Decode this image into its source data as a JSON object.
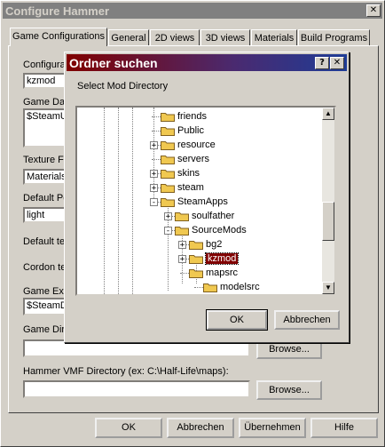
{
  "window": {
    "title": "Configure Hammer",
    "close_glyph": "✕"
  },
  "tabs": [
    "Game Configurations",
    "General",
    "2D views",
    "3D views",
    "Materials",
    "Build Programs"
  ],
  "panel": {
    "configurations_label": "Configurat",
    "configurations_value": "kzmod",
    "game_data_label": "Game Dat",
    "game_data_value": "$SteamU",
    "texture_format_label": "Texture Fo",
    "texture_format_value": "Materials",
    "default_point_label": "Default Po",
    "default_point_value": "light",
    "default_texture_label": "Default te",
    "cordon_texture_label": "Cordon te",
    "game_exe_label": "Game Exe",
    "game_exe_value": "$SteamD",
    "game_dir_label": "Game Dire",
    "game_dir_browse": "Browse...",
    "vmf_dir_label": "Hammer VMF Directory (ex: C:\\Half-Life\\maps):",
    "vmf_dir_browse": "Browse..."
  },
  "footer": {
    "ok": "OK",
    "cancel": "Abbrechen",
    "apply": "Übernehmen",
    "help": "Hilfe"
  },
  "dialog": {
    "title": "Ordner suchen",
    "help_glyph": "?",
    "close_glyph": "✕",
    "prompt": "Select Mod Directory",
    "ok": "OK",
    "cancel": "Abbrechen",
    "tree": [
      {
        "label": "friends"
      },
      {
        "label": "Public"
      },
      {
        "label": "resource",
        "expander": "+"
      },
      {
        "label": "servers"
      },
      {
        "label": "skins",
        "expander": "+"
      },
      {
        "label": "steam",
        "expander": "+"
      },
      {
        "label": "SteamApps",
        "expander": "-"
      },
      {
        "label": "soulfather",
        "expander": "+"
      },
      {
        "label": "SourceMods",
        "expander": "-"
      },
      {
        "label": "bg2",
        "expander": "+"
      },
      {
        "label": "kzmod",
        "expander": "+",
        "selected": true
      },
      {
        "label": "mapsrc"
      },
      {
        "label": "modelsrc"
      }
    ],
    "scroll_up": "▲",
    "scroll_down": "▼"
  },
  "colors": {
    "folder": "#f0c850",
    "selection": "#800000",
    "face": "#d4d0c8"
  }
}
